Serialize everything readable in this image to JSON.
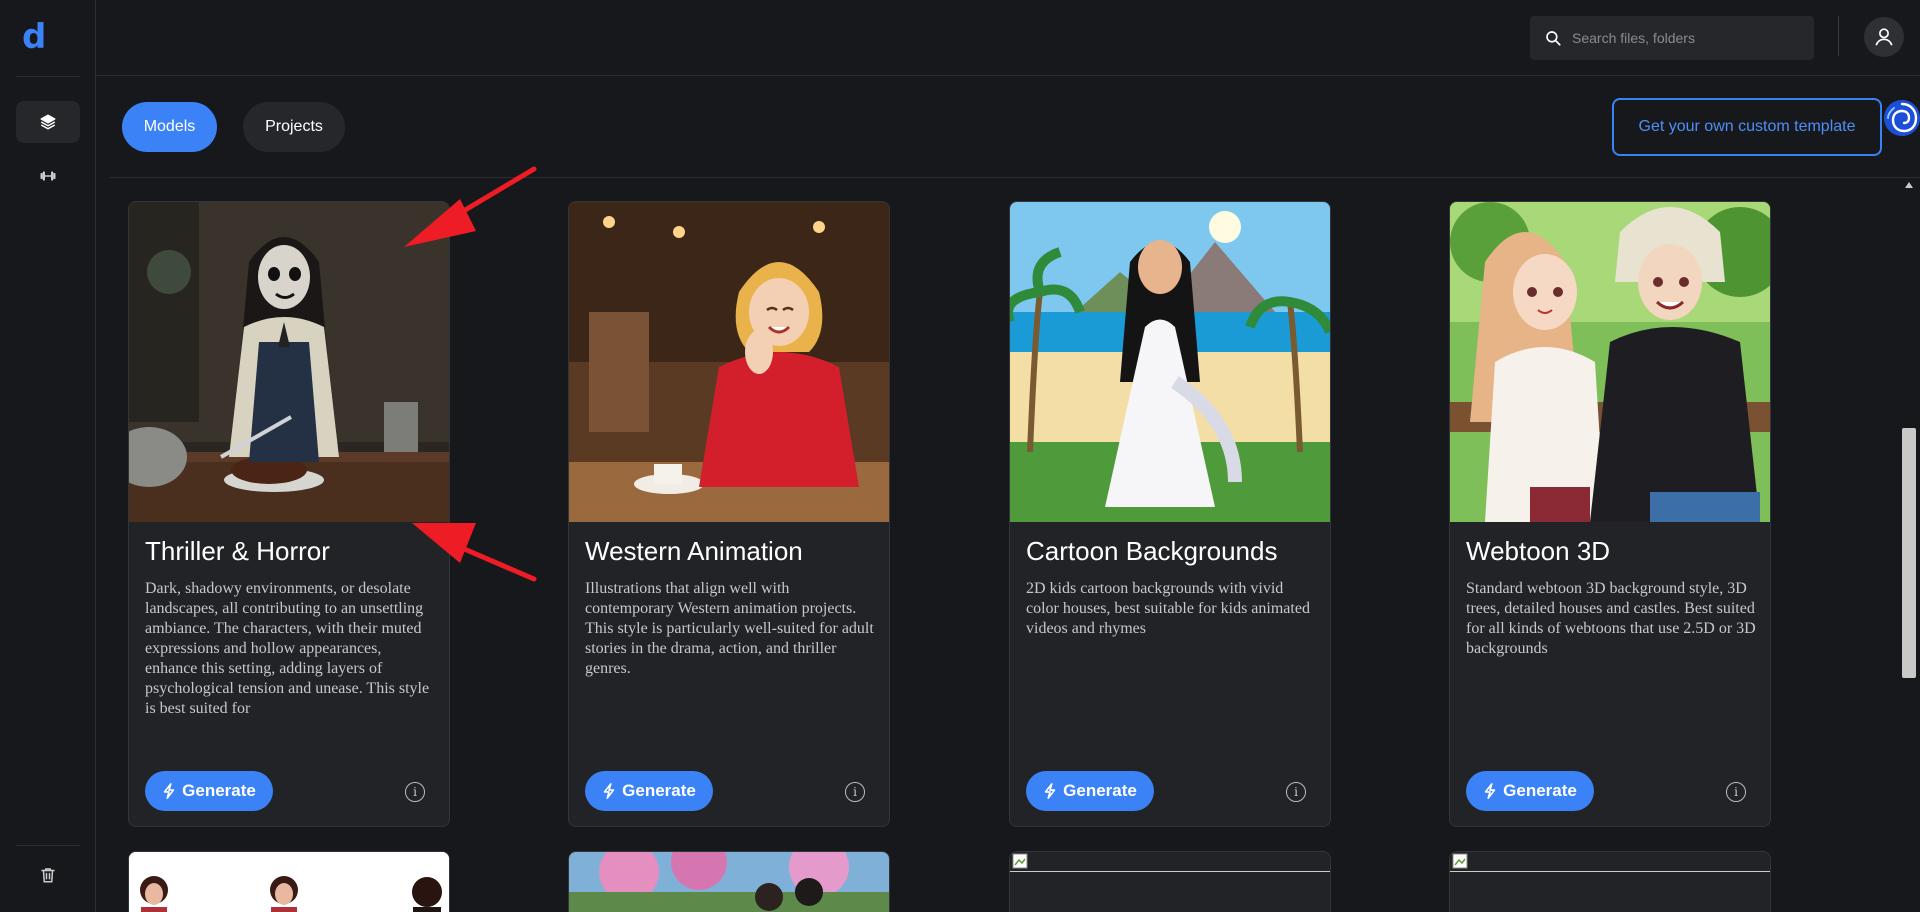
{
  "brand": {
    "logo_letter": "d"
  },
  "search": {
    "placeholder": "Search files, folders"
  },
  "tabs": [
    {
      "label": "Models"
    },
    {
      "label": "Projects"
    }
  ],
  "custom_template_label": "Get your own custom template",
  "cards": [
    {
      "title": "Thriller & Horror",
      "description": "Dark, shadowy environments, or desolate landscapes, all contributing to an unsettling ambiance. The characters, with their muted expressions and hollow appearances, enhance this setting, adding layers of psychological tension and unease. This style is best suited for"
    },
    {
      "title": "Western Animation",
      "description": "Illustrations that align well with contemporary Western animation projects. This style is particularly well-suited for adult stories in the drama, action, and thriller genres."
    },
    {
      "title": "Cartoon Backgrounds",
      "description": "2D kids cartoon backgrounds with vivid color houses, best suitable for kids animated videos and rhymes"
    },
    {
      "title": "Webtoon 3D",
      "description": "Standard webtoon 3D background style, 3D trees, detailed houses and castles. Best suited for all kinds of webtoons that use 2.5D or 3D backgrounds"
    }
  ],
  "generate_label": "Generate",
  "info_glyph": "i",
  "colors": {
    "accent": "#3b82f6",
    "background": "#17181b",
    "card": "#222327",
    "annotation_arrow": "#ee1c24"
  }
}
